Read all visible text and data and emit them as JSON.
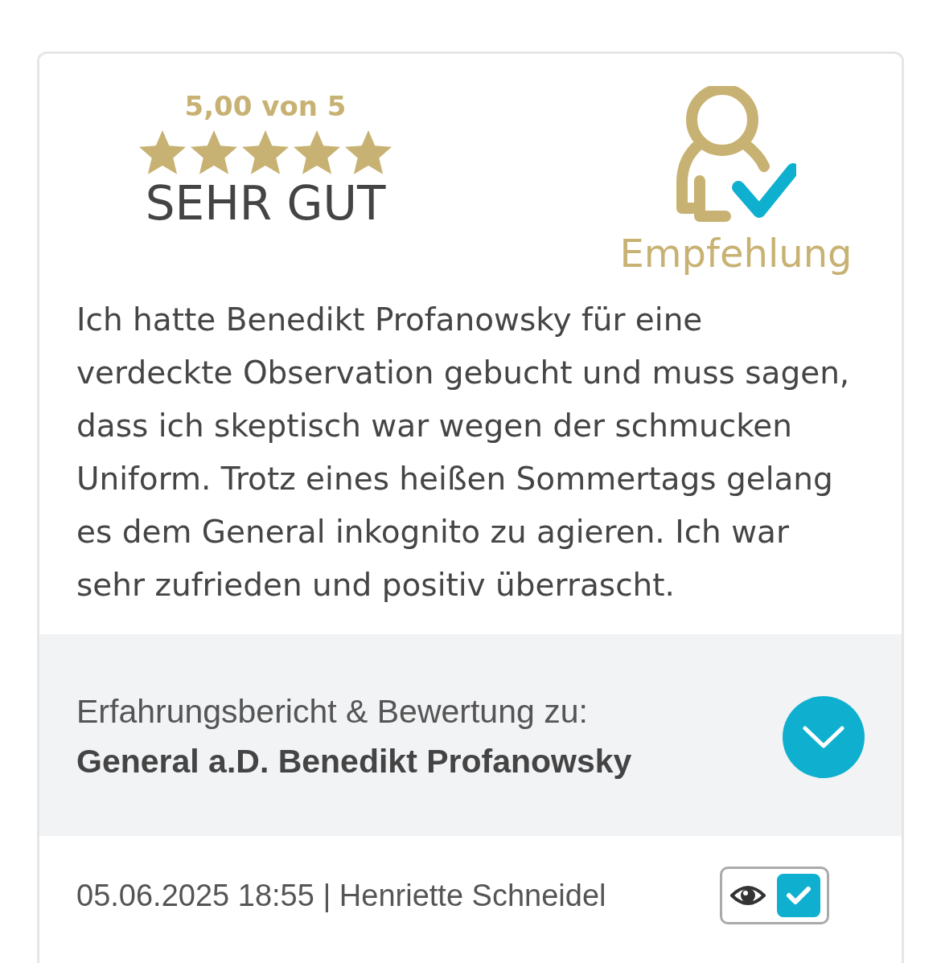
{
  "rating": {
    "score": "5,00 von 5",
    "stars": 5,
    "verdict": "SEHR GUT"
  },
  "recommendation": {
    "label": "Empfehlung"
  },
  "review_text": "Ich hatte Benedikt Profanowsky für eine verdeckte Observation gebucht und muss sagen, dass ich skeptisch war wegen der schmucken Uniform. Trotz eines heißen Sommertags gelang es dem General inkognito zu agieren. Ich war sehr zufrieden und positiv überrascht.",
  "subject": {
    "caption": "Erfahrungsbericht & Bewertung zu:",
    "name": "General a.D. Benedikt Profanowsky",
    "expanded": false
  },
  "footer": {
    "meta": "05.06.2025 18:55 | Henriette Schneidel",
    "visible_checked": true
  }
}
